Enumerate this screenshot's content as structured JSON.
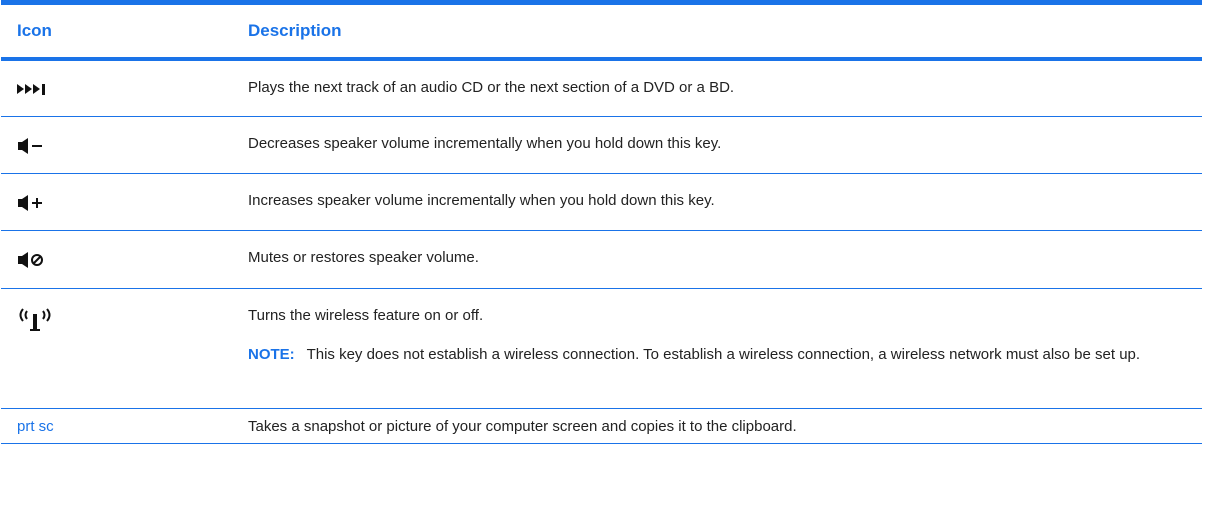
{
  "table": {
    "headers": {
      "icon": "Icon",
      "description": "Description"
    },
    "rows": [
      {
        "icon": "next-track-icon",
        "description": "Plays the next track of an audio CD or the next section of a DVD or a BD."
      },
      {
        "icon": "volume-down-icon",
        "description": "Decreases speaker volume incrementally when you hold down this key."
      },
      {
        "icon": "volume-up-icon",
        "description": "Increases speaker volume incrementally when you hold down this key."
      },
      {
        "icon": "mute-icon",
        "description": "Mutes or restores speaker volume."
      },
      {
        "icon": "wireless-icon",
        "description": "Turns the wireless feature on or off.",
        "note_label": "NOTE:",
        "note_text": "This key does not establish a wireless connection. To establish a wireless connection, a wireless network must also be set up."
      },
      {
        "key_label": "prt sc",
        "description": "Takes a snapshot or picture of your computer screen and copies it to the clipboard."
      }
    ]
  },
  "colors": {
    "accent": "#1a73e8",
    "text": "#222222"
  }
}
